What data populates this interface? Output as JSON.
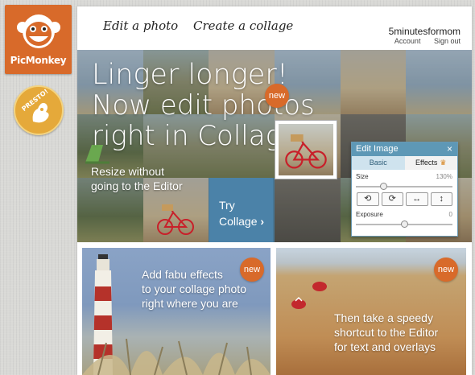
{
  "brand": {
    "logo_text": "PicMonkey",
    "presto_text": "PRESTO!"
  },
  "nav": {
    "edit_photo": "Edit a photo",
    "create_collage": "Create a collage"
  },
  "user": {
    "name": "5minutesformom",
    "account": "Account",
    "signout": "Sign out"
  },
  "hero": {
    "title_line1": "Linger longer!",
    "title_line2": "Now edit photos",
    "title_line3": "right in Collage",
    "sub_line1": "Resize without",
    "sub_line2": "going to the Editor",
    "try_line1": "Try",
    "try_line2": "Collage",
    "try_chevron": "›",
    "new_badge": "new"
  },
  "editor": {
    "title": "Edit Image",
    "close": "×",
    "tab_basic": "Basic",
    "tab_effects": "Effects",
    "crown": "♛",
    "size_label": "Size",
    "size_value": "130%",
    "size_level": 0.28,
    "exposure_label": "Exposure",
    "exposure_value": "0",
    "exposure_level": 0.5,
    "tools": [
      "⟲",
      "⟳",
      "↔",
      "↕"
    ]
  },
  "card_left": {
    "badge": "new",
    "line1": "Add fabu effects",
    "line2": "to your collage photo",
    "line3": "right where you are"
  },
  "card_right": {
    "badge": "new",
    "line1": "Then take a speedy",
    "line2": "shortcut to the Editor",
    "line3": "for text and overlays"
  }
}
